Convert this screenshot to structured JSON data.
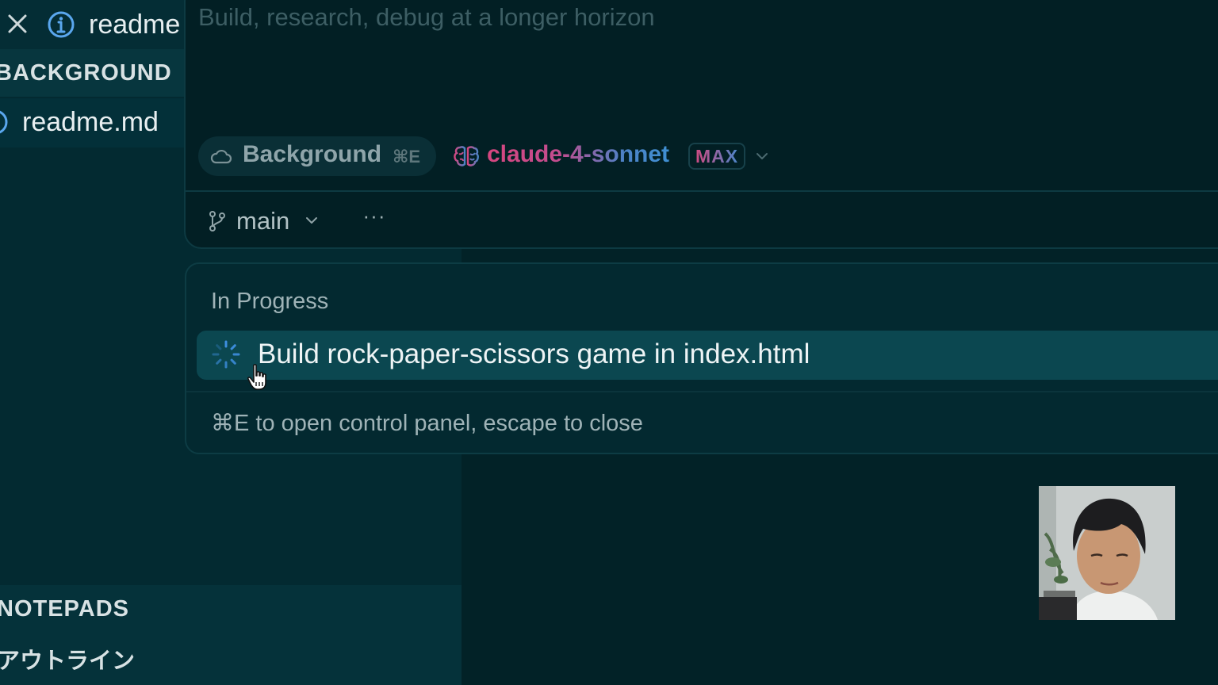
{
  "tab": {
    "label": "readme"
  },
  "sidebar": {
    "section_title": "BACKGROUND",
    "file": {
      "label": "readme.md"
    },
    "notepads_title": "NOTEPADS",
    "outline_label": "アウトライン"
  },
  "composer": {
    "placeholder": "Build, research, debug at a longer horizon",
    "mode_label": "Background",
    "mode_shortcut": "⌘E",
    "model_label": "claude-4-sonnet",
    "model_badge": "MAX",
    "branch_label": "main",
    "more_label": "···"
  },
  "panel": {
    "section_label": "In Progress",
    "tasks": [
      {
        "label": "Build rock-paper-scissors game in index.html",
        "status": "in-progress"
      }
    ],
    "hint": "⌘E to open control panel, escape to close"
  },
  "colors": {
    "background": "#022227",
    "accent_pink": "#d6467f",
    "accent_blue": "#3f8fd2",
    "selected_row": "#0b4750",
    "spinner": "#3e8fe0"
  }
}
